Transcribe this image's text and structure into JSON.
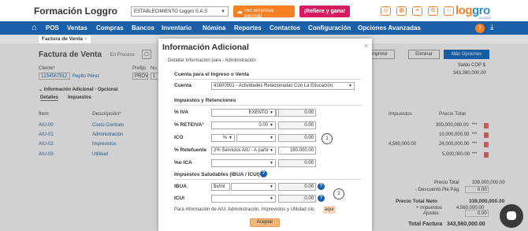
{
  "app": {
    "title": "Formación Loggro",
    "company_select": "ESTABLECIMIENTO Loggro S.A.S",
    "example_button": "Ver empresa ejemplo",
    "refer_button": "¡Refiere y gana!",
    "logo_part1": "log",
    "logo_part2": "gro",
    "logo_sub": "ALIADO",
    "notification_count": "2"
  },
  "nav": {
    "items": [
      "POS",
      "Ventas",
      "Compras",
      "Bancos",
      "Inventario",
      "Nómina",
      "Reportes",
      "Contactos",
      "Configuración",
      "Opciones Avanzadas"
    ]
  },
  "tab": {
    "label": "Factura de Venta",
    "close": "×"
  },
  "background": {
    "title": "Factura de Venta",
    "status": "- En Proceso",
    "buttons": {
      "print": "Imprimir",
      "delete": "Eliminar",
      "more": "Más Opciones"
    },
    "cliente_label": "Cliente*",
    "cliente_id": "1234567912",
    "cliente_name": "Pepito Pérez",
    "prefijo_label": "Prefijo",
    "prefijo_value": "PROV",
    "numero_label": "Nu",
    "numero_value": "1",
    "saldo_label": "Saldo COP $",
    "saldo_value": "343,380,000.00",
    "info_adicional": "Información Adicional - Opcional",
    "subtabs": [
      "Detalles",
      "Impuestos"
    ],
    "headers": {
      "item": "Ítem",
      "description": "Descripción*",
      "taxes": "Impuestos",
      "total": "Precio Total"
    },
    "rows": [
      {
        "item": "AIU-00",
        "description": "Costo Contrato",
        "tax": "",
        "total": "300,000,000.00"
      },
      {
        "item": "AIU-01",
        "description": "Administración",
        "tax": "",
        "total": "10,000,000.00"
      },
      {
        "item": "AIU-02",
        "description": "Imprevistos",
        "tax": "4,560,000.00",
        "total": "24,000,000.00"
      },
      {
        "item": "AIU-03",
        "description": "Utilidad",
        "tax": "",
        "total": "5,000,000.00"
      }
    ],
    "totals": {
      "precio_total_label": "Precio Total",
      "precio_total_value": "339,000,000.00",
      "descuento_label": "- Descuento Pie Pág.",
      "descuento_value": "0.00",
      "neto_label": "Precio Total Neto",
      "neto_value": "339,000,000.00",
      "impuestos_label": "+ Impuestos",
      "impuestos_value": "4,560,000.00",
      "ajustes_label": "Ajustes",
      "ajustes_value": "0.00",
      "total_label": "Total Factura",
      "total_value": "343,560,000.00"
    }
  },
  "modal": {
    "title": "Información Adicional",
    "close": "×",
    "subtitle": "Detallar Información para - Administración",
    "section_cuenta": "Cuenta para el Ingreso o Venta",
    "cuenta_label": "Cuenta",
    "cuenta_value": "41600501 - Actividades Relacionadas Con La Educación",
    "section_impuestos": "Impuestos y Retenciones",
    "iva_label": "% IVA",
    "iva_select": "EXENTO",
    "iva_amount": "0.00",
    "reteiva_label": "% RETEIVA",
    "reteiva_req": "*",
    "reteiva_select": "0.00",
    "reteiva_amount": "0.00",
    "ico_label": "ICO",
    "ico_select": "%",
    "ico_amount": "0.00",
    "retefuente_label": "% Retefuente",
    "retefuente_select": "2% Servicios AIU - A partir",
    "retefuente_amount": "180,000.00",
    "ica_label": "%o ICA",
    "ica_amount": "0.00",
    "section_saludables": "Impuestos Saludables (IBUA / ICUI)",
    "ibua_label": "IBUA",
    "ibua_unit": "$x/ml",
    "ibua_amount": "0.00",
    "icui_label": "ICUI",
    "icui_amount": "0.00",
    "note": "Para información de AIU: Administración, Imprevistos y Utilidad clic",
    "note_link": "aquí",
    "accept": "Aceptar",
    "mark1": "1",
    "mark2": "2"
  }
}
